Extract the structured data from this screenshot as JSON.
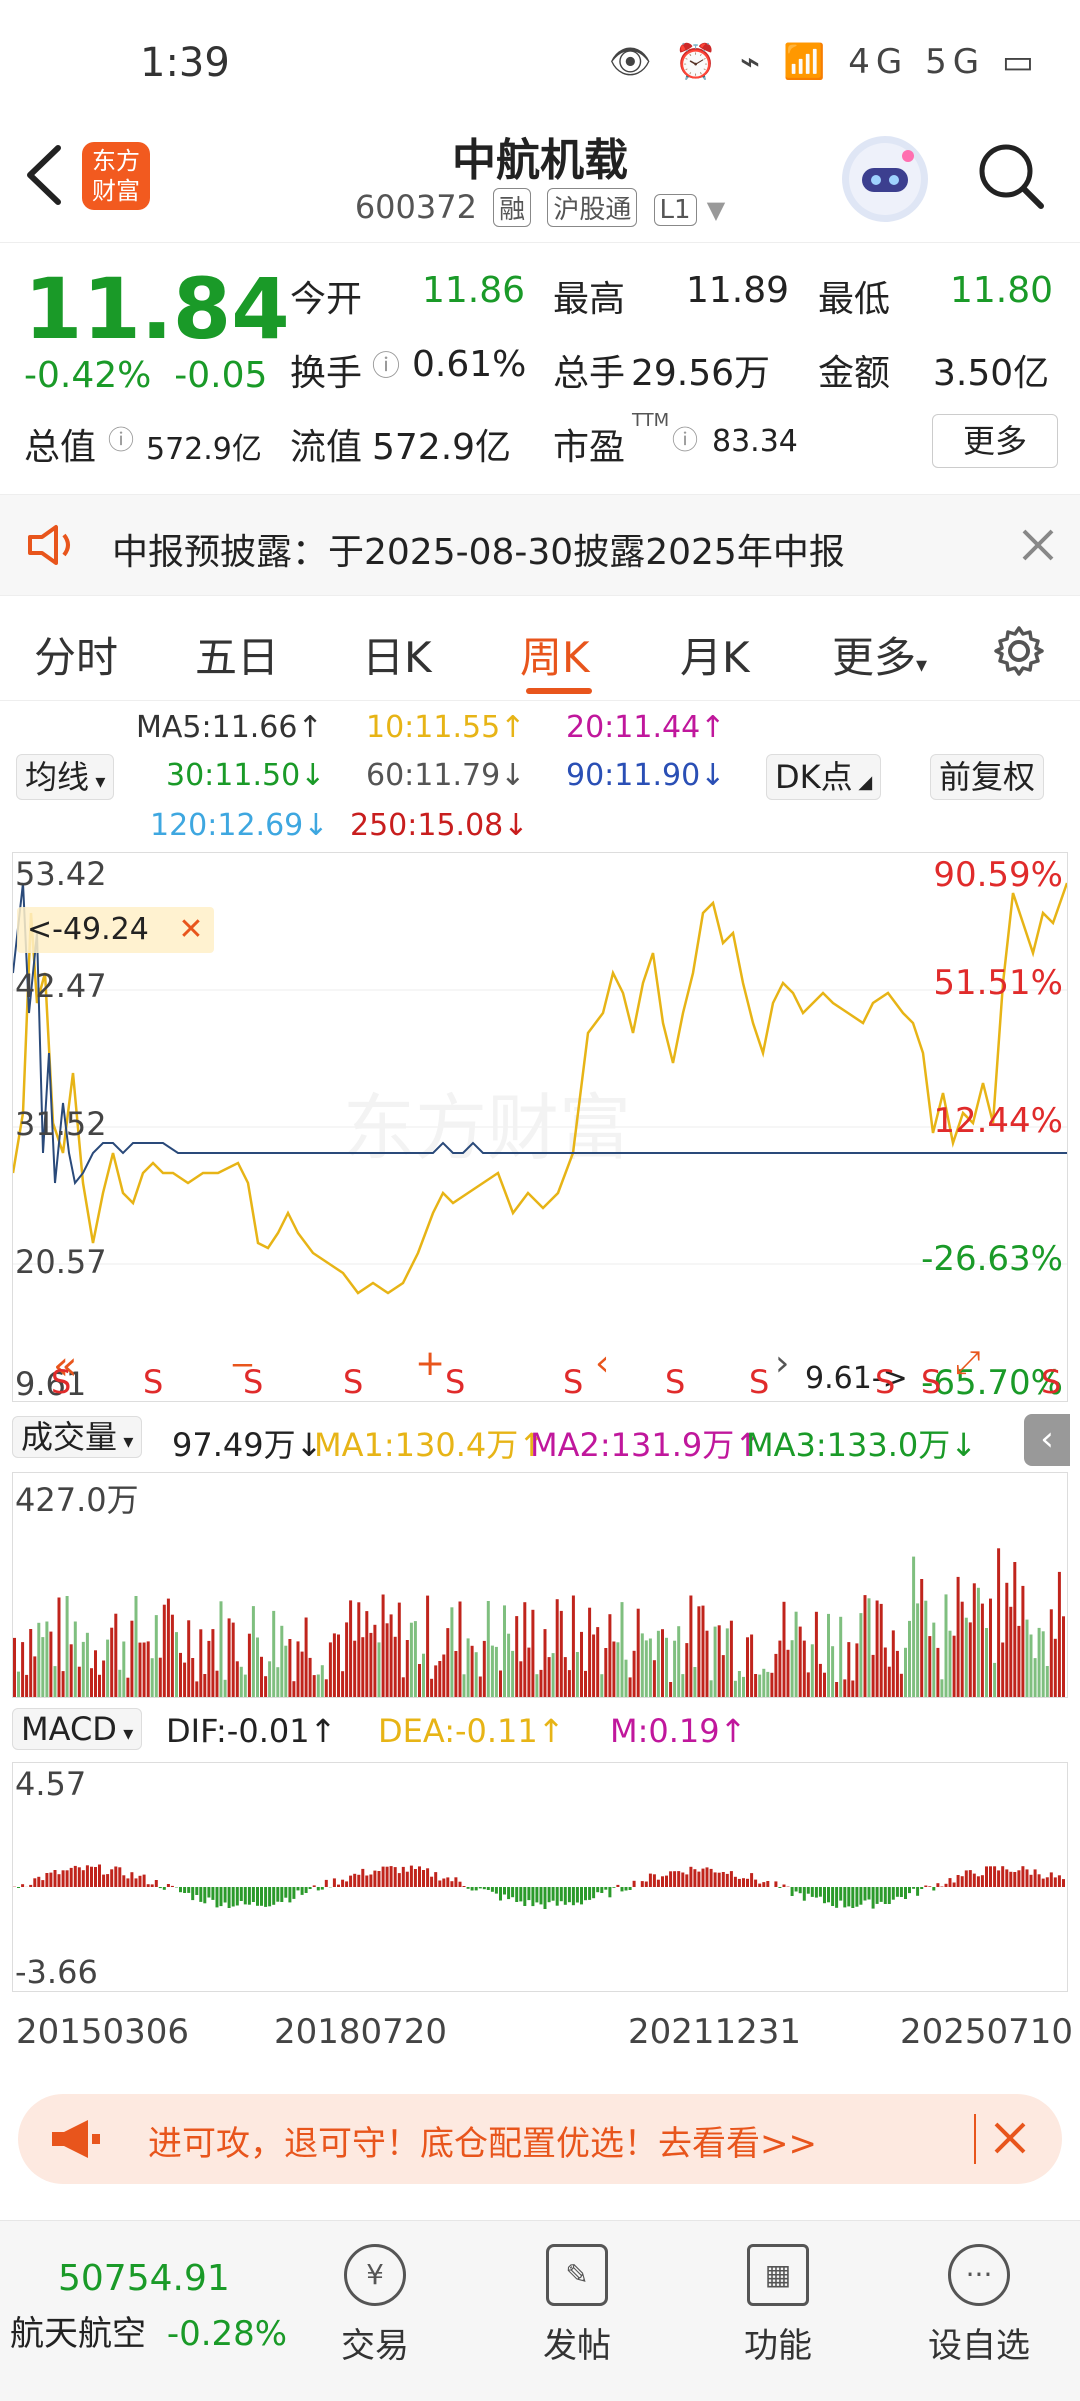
{
  "status_bar": {
    "time": "1:39",
    "icons_text": "👁 ⏰ ⌁ 📶 4G 5G ▭"
  },
  "header": {
    "logo_text": [
      "东方",
      "财富"
    ],
    "title": "中航机载",
    "code": "600372",
    "tags": [
      "融",
      "沪股通",
      "L1"
    ]
  },
  "quote": {
    "price": "11.84",
    "change_pct": "-0.42%",
    "change_amt": "-0.05",
    "open_label": "今开",
    "open": "11.86",
    "high_label": "最高",
    "high": "11.89",
    "low_label": "最低",
    "low": "11.80",
    "turnover_label": "换手",
    "turnover": "0.61%",
    "volume_label": "总手",
    "volume": "29.56万",
    "amount_label": "金额",
    "amount": "3.50亿",
    "mktcap_label": "总值",
    "mktcap": "572.9亿",
    "float_label": "流值",
    "float": "572.9亿",
    "pe_label": "市盈",
    "pe_sup": "TTM",
    "pe": "83.34",
    "more": "更多"
  },
  "notice": {
    "text": "中报预披露：于2025-08-30披露2025年中报"
  },
  "tabs": {
    "items": [
      "分时",
      "五日",
      "日K",
      "周K",
      "月K",
      "更多"
    ],
    "active": "周K"
  },
  "ma_lines": {
    "ma5": "MA5:11.66↑",
    "ma10": "10:11.55↑",
    "ma20": "20:11.44↑",
    "ma30": "30:11.50↓",
    "ma60": "60:11.79↓",
    "ma90": "90:11.90↓",
    "ma120": "120:12.69↓",
    "ma250": "250:15.08↓",
    "avg_btn": "均线",
    "dk_btn": "DK点",
    "adj_btn": "前复权",
    "colors": {
      "ma5": "#333333",
      "ma10": "#e7b416",
      "ma20": "#c0179c",
      "ma30": "#1a9a28",
      "ma60": "#555555",
      "ma90": "#2a4fb5",
      "ma120": "#3ea7e0",
      "ma250": "#c81e1e"
    }
  },
  "main_chart": {
    "y_labels": [
      "53.42",
      "42.47",
      "31.52",
      "20.57",
      "9.61"
    ],
    "pct_labels": [
      "90.59%",
      "51.51%",
      "12.44%",
      "-26.63%",
      "-65.70%"
    ],
    "measure": "<-49.24",
    "min_marker": "9.61->",
    "watermark": "东方财富",
    "s_marks": [
      "S",
      "S",
      "S",
      "S",
      "S",
      "S",
      "S",
      "S",
      "S",
      "S",
      "S"
    ]
  },
  "volume": {
    "btn": "成交量",
    "value": "97.49万↓",
    "ma1": "MA1:130.4万↑",
    "ma2": "MA2:131.9万↑",
    "ma3": "MA3:133.0万↓",
    "max_label": "427.0万"
  },
  "macd": {
    "btn": "MACD",
    "dif": "DIF:-0.01↑",
    "dea": "DEA:-0.11↑",
    "m": "M:0.19↑",
    "top_label": "4.57",
    "bottom_label": "-3.66"
  },
  "dates": [
    "20150306",
    "20180720",
    "20211231",
    "20250710"
  ],
  "chart_data": {
    "type": "line",
    "title": "",
    "x": [
      "20150306",
      "20180720",
      "20211231",
      "20250710"
    ],
    "ylim": [
      9.61,
      53.42
    ],
    "series": [
      {
        "name": "",
        "values": []
      }
    ]
  },
  "banner": {
    "text": "进可攻，退可守！底仓配置优选！去看看>>"
  },
  "bottom": {
    "index_value": "50754.91",
    "index_name": "航天航空",
    "index_change": "-0.28%",
    "nav": [
      "交易",
      "发帖",
      "功能",
      "设自选"
    ]
  }
}
